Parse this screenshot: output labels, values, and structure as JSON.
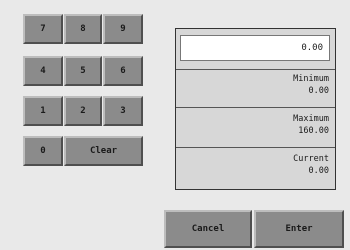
{
  "keypad": {
    "k7": "7",
    "k8": "8",
    "k9": "9",
    "k4": "4",
    "k5": "5",
    "k6": "6",
    "k1": "1",
    "k2": "2",
    "k3": "3",
    "k0": "0",
    "clear": "Clear"
  },
  "entry": {
    "value": "0.00"
  },
  "limits": {
    "minimum_label": "Minimum",
    "minimum_value": "0.00",
    "maximum_label": "Maximum",
    "maximum_value": "160.00",
    "current_label": "Current",
    "current_value": "0.00"
  },
  "actions": {
    "cancel": "Cancel",
    "enter": "Enter"
  }
}
